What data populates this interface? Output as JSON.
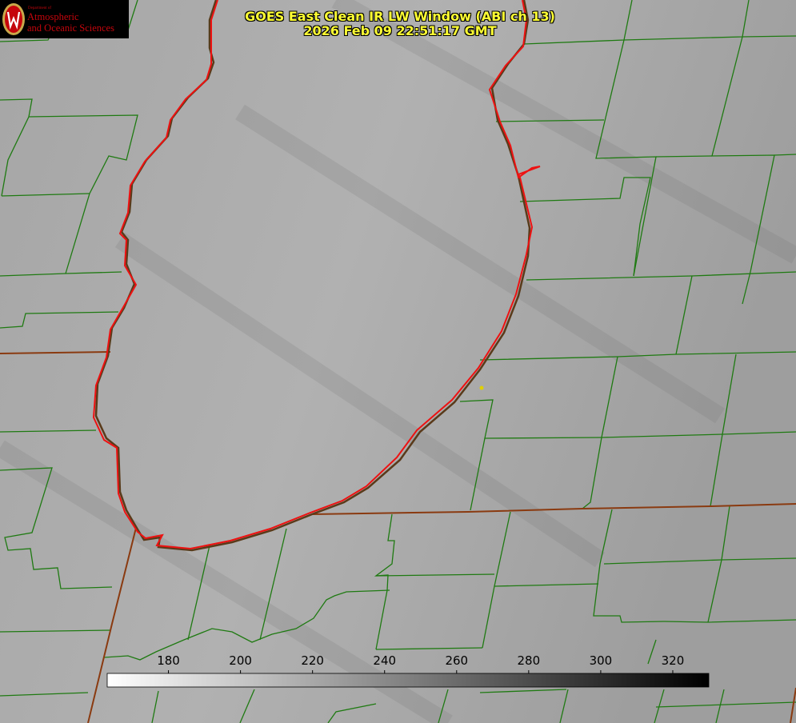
{
  "logo": {
    "dept": "Department of",
    "line1": "Atmospheric",
    "line2": "and Oceanic Sciences"
  },
  "title": {
    "line1": "GOES East Clean IR LW Window (ABI ch 13)",
    "line2": "2026 Feb 09 22:51:17 GMT"
  },
  "colorbar": {
    "ticks": [
      "180",
      "200",
      "220",
      "240",
      "260",
      "280",
      "300",
      "320"
    ],
    "min": 163,
    "max": 330
  },
  "colors": {
    "background": "#a9a9a9",
    "county_lines": "#1f7a12",
    "state_lines": "#8a3a10",
    "lake_outline": "#ee1111",
    "title_text": "#ffff33"
  }
}
